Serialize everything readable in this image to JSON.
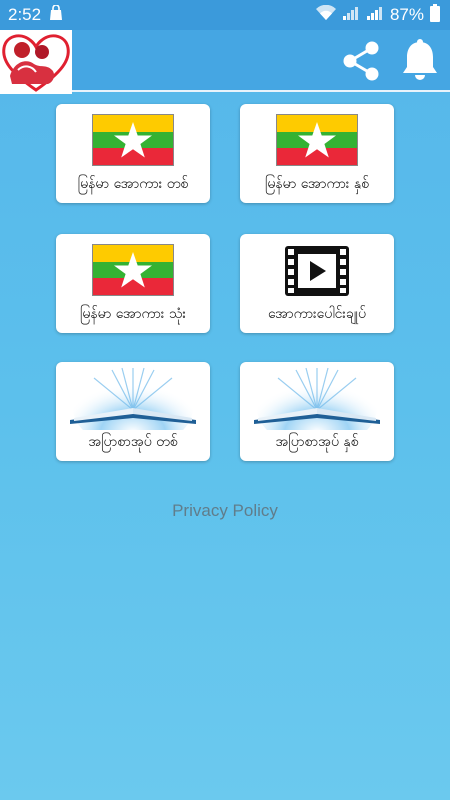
{
  "status_bar": {
    "time": "2:52",
    "battery_percent": "87%",
    "icons": [
      "bag-icon",
      "wifi-icon",
      "signal-icon",
      "signal-icon",
      "battery-icon"
    ]
  },
  "app_bar": {
    "logo": "couple-heart-logo",
    "actions": [
      "share-icon",
      "bell-icon"
    ],
    "color": "#45a6e3"
  },
  "menu": {
    "items": [
      {
        "label": "မြန်မာ အောကား တစ်",
        "icon": "myanmar-flag-icon"
      },
      {
        "label": "မြန်မာ အောကား နှစ်",
        "icon": "myanmar-flag-icon"
      },
      {
        "label": "မြန်မာ အောကား သုံး",
        "icon": "myanmar-flag-icon"
      },
      {
        "label": "အောကားပေါင်းချုပ်",
        "icon": "film-icon"
      },
      {
        "label": "အပြာစာအုပ် တစ်",
        "icon": "open-book-icon"
      },
      {
        "label": "အပြာစာအုပ် နှစ်",
        "icon": "open-book-icon"
      }
    ]
  },
  "footer": {
    "privacy_link": "Privacy Policy"
  },
  "colors": {
    "background_top": "#55b6ea",
    "background_bottom": "#6bc9ee",
    "flag_yellow": "#fecb00",
    "flag_green": "#34b233",
    "flag_red": "#ea2839"
  }
}
